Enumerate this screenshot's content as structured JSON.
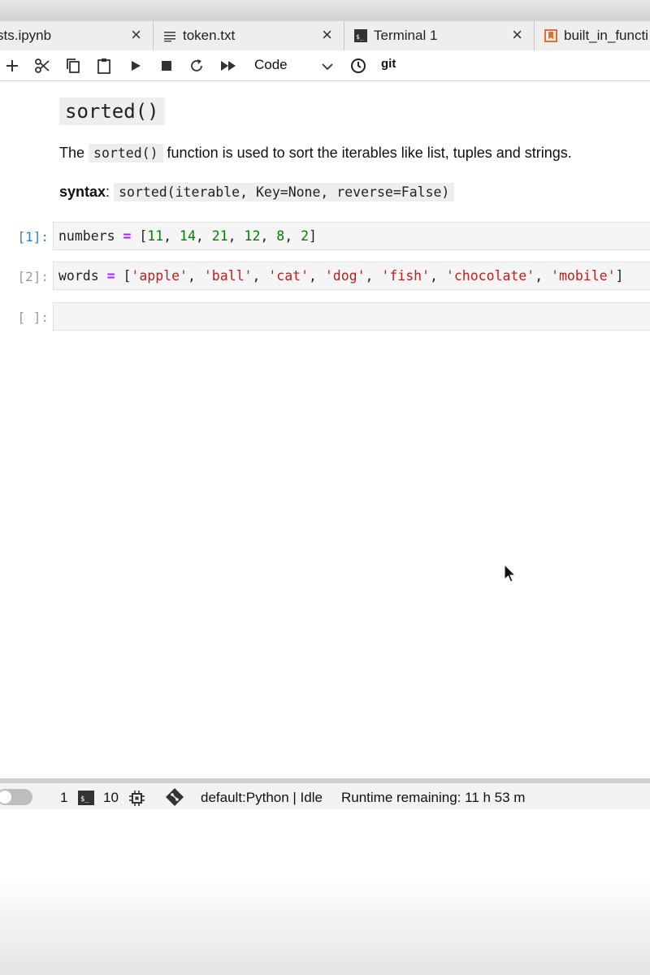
{
  "tabs": [
    {
      "label": "sts.ipynb",
      "close": "×"
    },
    {
      "label": "token.txt",
      "close": "×"
    },
    {
      "label": "Terminal 1",
      "close": "×"
    },
    {
      "label": "built_in_functi"
    }
  ],
  "toolbar": {
    "cell_type": "Code",
    "git_label": "git"
  },
  "markdown": {
    "heading": "sorted()",
    "desc_prefix": "The",
    "desc_code": "sorted()",
    "desc_suffix": "function is used to sort the iterables like list, tuples and strings.",
    "syntax_label": "syntax",
    "syntax_colon": ":",
    "syntax_code": "sorted(iterable, Key=None, reverse=False)"
  },
  "cells": [
    {
      "prompt": "[1]:"
    },
    {
      "prompt": "[2]:"
    },
    {
      "prompt": "[ ]:"
    }
  ],
  "code": {
    "numbers_var": "numbers",
    "assign": "=",
    "numbers_values": [
      "11",
      "14",
      "21",
      "12",
      "8",
      "2"
    ],
    "words_var": "words",
    "words_values": [
      "'apple'",
      "'ball'",
      "'cat'",
      "'dog'",
      "'fish'",
      "'chocolate'",
      "'mobile'"
    ]
  },
  "statusbar": {
    "count_1": "1",
    "terminal_count": "10",
    "kernel": "default:Python | Idle",
    "runtime": "Runtime remaining: 11 h 53 m"
  }
}
